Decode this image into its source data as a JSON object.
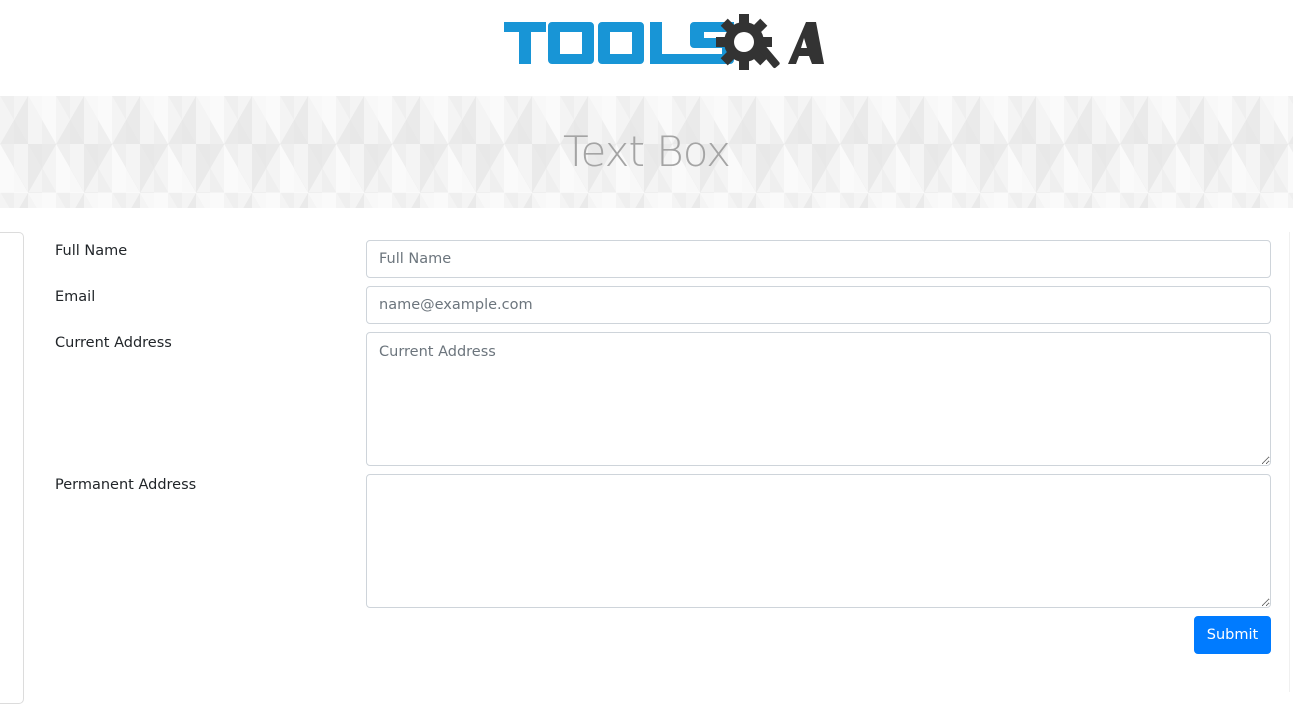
{
  "header": {
    "logo_text": "TOOLSQA",
    "logo_colors": {
      "tools": "#1895d6",
      "qa": "#333333"
    }
  },
  "banner": {
    "title": "Text Box"
  },
  "form": {
    "full_name": {
      "label": "Full Name",
      "placeholder": "Full Name",
      "value": ""
    },
    "email": {
      "label": "Email",
      "placeholder": "name@example.com",
      "value": ""
    },
    "current_address": {
      "label": "Current Address",
      "placeholder": "Current Address",
      "value": ""
    },
    "permanent_address": {
      "label": "Permanent Address",
      "placeholder": "",
      "value": ""
    },
    "submit_label": "Submit"
  },
  "colors": {
    "primary": "#007bff",
    "banner_text": "#a4a4a4",
    "input_border": "#ced4da",
    "placeholder": "#6c757d"
  }
}
